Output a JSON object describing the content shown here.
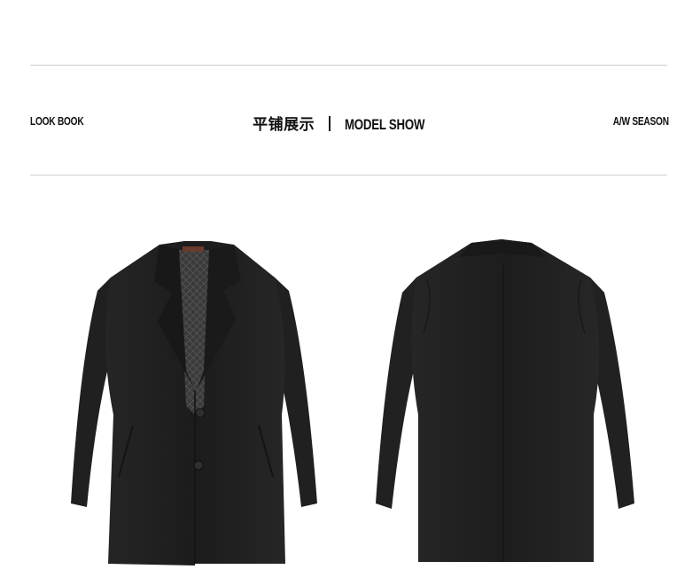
{
  "header": {
    "left_label": "LOOK BOOK",
    "title_cn": "平铺展示",
    "title_en": "MODEL SHOW",
    "right_label": "A/W SEASON"
  },
  "products": [
    {
      "view": "front",
      "color": "#1f1f1f"
    },
    {
      "view": "back",
      "color": "#1f1f1f"
    }
  ]
}
